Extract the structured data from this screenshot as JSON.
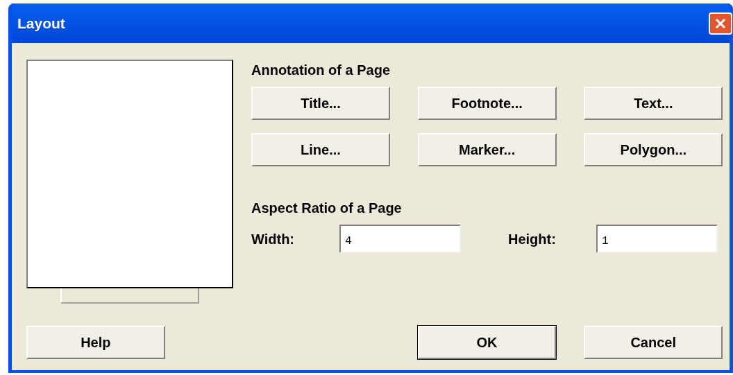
{
  "window": {
    "title": "Layout"
  },
  "preview": {
    "select_button": {
      "disabled": true
    }
  },
  "annotation": {
    "heading": "Annotation of a Page",
    "buttons": [
      "Title...",
      "Footnote...",
      "Text...",
      "Line...",
      "Marker...",
      "Polygon..."
    ]
  },
  "aspect": {
    "heading": "Aspect Ratio of a Page",
    "fields": [
      {
        "label": "Width:",
        "value": "4"
      },
      {
        "label": "Height:",
        "value": "1"
      }
    ]
  },
  "footer": {
    "help": "Help",
    "ok": "OK",
    "cancel": "Cancel"
  }
}
